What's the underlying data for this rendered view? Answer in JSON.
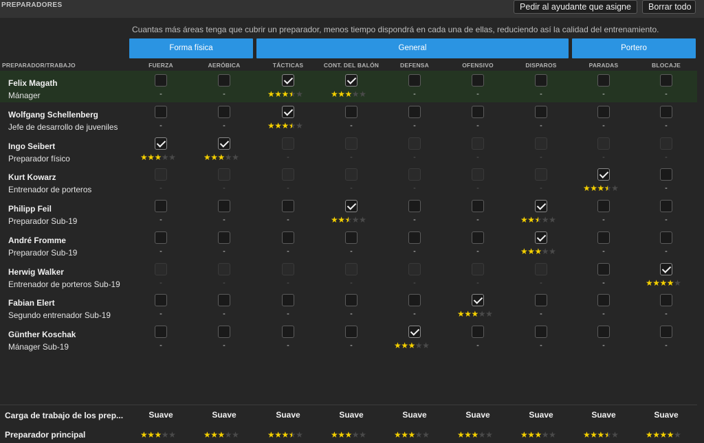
{
  "panel": {
    "title": "PREPARADORES",
    "buttons": {
      "ask_assistant": "Pedir al ayudante que asigne",
      "clear_all": "Borrar todo"
    },
    "info": "Cuantas más áreas tenga que cubrir un preparador, menos tiempo dispondrá en cada una de ellas, reduciendo así la calidad del entrenamiento."
  },
  "groups": [
    {
      "label": "Forma física"
    },
    {
      "label": "General"
    },
    {
      "label": "Portero"
    }
  ],
  "table_header": "PREPARADOR/TRABAJO",
  "columns": [
    "FUERZA",
    "AERÓBICA",
    "TÁCTICAS",
    "CONT. DEL BALÓN",
    "DEFENSA",
    "OFENSIVO",
    "DISPAROS",
    "PARADAS",
    "BLOCAJE"
  ],
  "coaches": [
    {
      "name": "Felix Magath",
      "role": "Mánager",
      "highlight": true,
      "cells": [
        {
          "c": false
        },
        {
          "c": false
        },
        {
          "c": true,
          "r": 3.5
        },
        {
          "c": true,
          "r": 3
        },
        {
          "c": false
        },
        {
          "c": false
        },
        {
          "c": false
        },
        {
          "c": false
        },
        {
          "c": false
        }
      ]
    },
    {
      "name": "Wolfgang Schellenberg",
      "role": "Jefe de desarrollo de juveniles",
      "cells": [
        {
          "c": false
        },
        {
          "c": false
        },
        {
          "c": true,
          "r": 3.5
        },
        {
          "c": false
        },
        {
          "c": false
        },
        {
          "c": false
        },
        {
          "c": false
        },
        {
          "c": false
        },
        {
          "c": false
        }
      ]
    },
    {
      "name": "Ingo Seibert",
      "role": "Preparador físico",
      "cells": [
        {
          "c": true,
          "r": 3
        },
        {
          "c": true,
          "r": 3
        },
        {
          "d": true
        },
        {
          "d": true
        },
        {
          "d": true
        },
        {
          "d": true
        },
        {
          "d": true
        },
        {
          "d": true
        },
        {
          "d": true
        }
      ]
    },
    {
      "name": "Kurt Kowarz",
      "role": "Entrenador de porteros",
      "cells": [
        {
          "d": true
        },
        {
          "d": true
        },
        {
          "d": true
        },
        {
          "d": true
        },
        {
          "d": true
        },
        {
          "d": true
        },
        {
          "d": true
        },
        {
          "c": true,
          "r": 3.5
        },
        {
          "c": false
        }
      ]
    },
    {
      "name": "Philipp Feil",
      "role": "Preparador Sub-19",
      "cells": [
        {
          "c": false
        },
        {
          "c": false
        },
        {
          "c": false
        },
        {
          "c": true,
          "r": 2.5
        },
        {
          "c": false
        },
        {
          "c": false
        },
        {
          "c": true,
          "r": 2.5
        },
        {
          "c": false
        },
        {
          "c": false
        }
      ]
    },
    {
      "name": "André Fromme",
      "role": "Preparador Sub-19",
      "cells": [
        {
          "c": false
        },
        {
          "c": false
        },
        {
          "c": false
        },
        {
          "c": false
        },
        {
          "c": false
        },
        {
          "c": false
        },
        {
          "c": true,
          "r": 3
        },
        {
          "c": false
        },
        {
          "c": false
        }
      ]
    },
    {
      "name": "Herwig Walker",
      "role": "Entrenador de porteros Sub-19",
      "cells": [
        {
          "d": true
        },
        {
          "d": true
        },
        {
          "d": true
        },
        {
          "d": true
        },
        {
          "d": true
        },
        {
          "d": true
        },
        {
          "d": true
        },
        {
          "c": false
        },
        {
          "c": true,
          "r": 4
        }
      ]
    },
    {
      "name": "Fabian Elert",
      "role": "Segundo entrenador Sub-19",
      "cells": [
        {
          "c": false
        },
        {
          "c": false
        },
        {
          "c": false
        },
        {
          "c": false
        },
        {
          "c": false
        },
        {
          "c": true,
          "r": 3
        },
        {
          "c": false
        },
        {
          "c": false
        },
        {
          "c": false
        }
      ]
    },
    {
      "name": "Günther Koschak",
      "role": "Mánager Sub-19",
      "cells": [
        {
          "c": false
        },
        {
          "c": false
        },
        {
          "c": false
        },
        {
          "c": false
        },
        {
          "c": true,
          "r": 3
        },
        {
          "c": false
        },
        {
          "c": false
        },
        {
          "c": false
        },
        {
          "c": false
        }
      ]
    }
  ],
  "dash": "-",
  "footer": {
    "workload_label": "Carga de trabajo de los prep...",
    "workload": [
      "Suave",
      "Suave",
      "Suave",
      "Suave",
      "Suave",
      "Suave",
      "Suave",
      "Suave",
      "Suave"
    ],
    "principal_label": "Preparador principal",
    "principal_ratings": [
      3,
      3,
      3.5,
      3,
      3,
      3,
      3,
      3.5,
      4
    ]
  },
  "colors": {
    "accent": "#2b94e2",
    "star": "#f5d000",
    "highlight_row": "#243522"
  },
  "icons": {
    "checkbox": "checkmark-icon",
    "rating": "star-icon"
  }
}
